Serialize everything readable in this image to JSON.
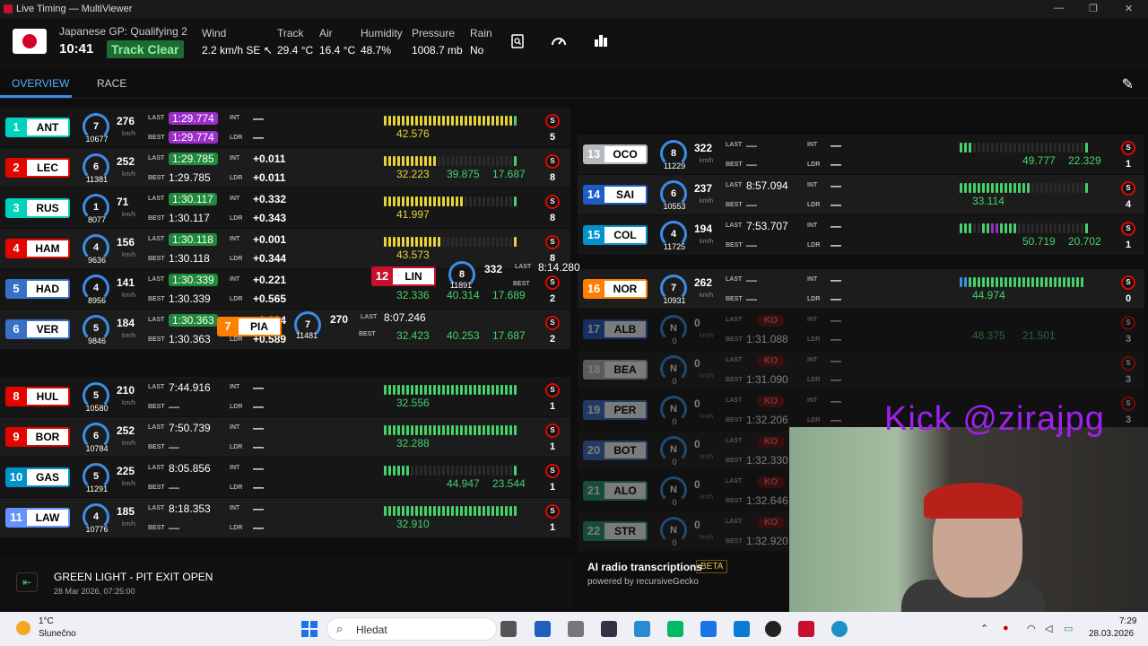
{
  "window": {
    "title": "Live Timing — MultiViewer",
    "min": "—",
    "max": "❐",
    "close": "✕"
  },
  "session": {
    "name": "Japanese GP: Qualifying 2",
    "clock": "10:41",
    "track_status": "Track Clear"
  },
  "weather": [
    {
      "label": "Wind",
      "value": "2.2 km/h SE ↖"
    },
    {
      "label": "Track",
      "value": "29.4 °C"
    },
    {
      "label": "Air",
      "value": "16.4 °C"
    },
    {
      "label": "Humidity",
      "value": "48.7%"
    },
    {
      "label": "Pressure",
      "value": "1008.7 mb"
    },
    {
      "label": "Rain",
      "value": "No"
    }
  ],
  "nav": {
    "tabs": [
      "OVERVIEW",
      "RACE"
    ],
    "active": "OVERVIEW"
  },
  "labels": {
    "last": "LAST",
    "best": "BEST",
    "int": "INT",
    "ldr": "LDR",
    "kmh": "km/h",
    "dash": "—",
    "ko": "KO",
    "tyre": "S"
  },
  "colors": {
    "accent": "#3a8ee6",
    "purple": "#9b2ec9",
    "green": "#1e8a3a",
    "yellow": "#e6d33a"
  },
  "left_drivers": [
    {
      "pos": "1",
      "code": "ANT",
      "team_color": "#00d2be",
      "gear": "7",
      "rpm": "10677",
      "speed": "276",
      "last": "1:29.774",
      "last_style": "purple",
      "best": "1:29.774",
      "best_style": "purple",
      "int": "—",
      "ldr": "—",
      "s1": "42.576",
      "s2": "",
      "s3": "",
      "laps": "5",
      "bars": "yyyyyyyyyyyyyyyyyyyyyyyyyyyyyg"
    },
    {
      "pos": "2",
      "code": "LEC",
      "team_color": "#e10600",
      "gear": "6",
      "rpm": "11381",
      "speed": "252",
      "last": "1:29.785",
      "last_style": "green",
      "best": "1:29.785",
      "best_style": "",
      "int": "+0.011",
      "ldr": "+0.011",
      "s1": "32.223",
      "s2": "39.875",
      "s3": "17.687",
      "laps": "8",
      "bars": "yyyyyyyyyyyy                 g"
    },
    {
      "pos": "3",
      "code": "RUS",
      "team_color": "#00d2be",
      "gear": "1",
      "rpm": "8077",
      "speed": "71",
      "last": "1:30.117",
      "last_style": "green",
      "best": "1:30.117",
      "best_style": "",
      "int": "+0.332",
      "ldr": "+0.343",
      "s1": "41.997",
      "s2": "",
      "s3": "",
      "laps": "8",
      "bars": "yyyyyyyyyyyyyyyyyy           g"
    },
    {
      "pos": "4",
      "code": "HAM",
      "team_color": "#e10600",
      "gear": "4",
      "rpm": "9636",
      "speed": "156",
      "last": "1:30.118",
      "last_style": "green",
      "best": "1:30.118",
      "best_style": "",
      "int": "+0.001",
      "ldr": "+0.344",
      "s1": "43.573",
      "s2": "",
      "s3": "",
      "laps": "8",
      "bars": "yyyyyyyyyyyyy                y"
    },
    {
      "pos": "5",
      "code": "HAD",
      "team_color": "#3671c6",
      "gear": "4",
      "rpm": "8956",
      "speed": "141",
      "last": "1:30.339",
      "last_style": "green",
      "best": "1:30.339",
      "best_style": "",
      "int": "+0.221",
      "ldr": "+0.565",
      "s1": "32.336",
      "s2": "40.314",
      "s3": "17.689",
      "laps": "2",
      "bars": ""
    },
    {
      "pos": "6",
      "code": "VER",
      "team_color": "#3671c6",
      "gear": "5",
      "rpm": "9846",
      "speed": "184",
      "last": "1:30.363",
      "last_style": "green",
      "best": "1:30.363",
      "best_style": "",
      "int": "+0.024",
      "ldr": "+0.589",
      "s1": "32.423",
      "s2": "40.253",
      "s3": "17.687",
      "laps": "2",
      "bars": ""
    },
    {
      "pos": "8",
      "code": "HUL",
      "team_color": "#e10600",
      "gear": "5",
      "rpm": "10580",
      "speed": "210",
      "last": "7:44.916",
      "last_style": "",
      "best": "—",
      "best_style": "",
      "int": "—",
      "ldr": "—",
      "s1": "32.556",
      "s2": "",
      "s3": "",
      "laps": "1",
      "bars": "gggggggggggggggggggggggggggggg"
    },
    {
      "pos": "9",
      "code": "BOR",
      "team_color": "#e10600",
      "gear": "6",
      "rpm": "10784",
      "speed": "252",
      "last": "7:50.739",
      "last_style": "",
      "best": "—",
      "best_style": "",
      "int": "—",
      "ldr": "—",
      "s1": "32.288",
      "s2": "",
      "s3": "",
      "laps": "1",
      "bars": "gggggggggggggggggggggggggggggg"
    },
    {
      "pos": "10",
      "code": "GAS",
      "team_color": "#0093cc",
      "gear": "5",
      "rpm": "11291",
      "speed": "225",
      "last": "8:05.856",
      "last_style": "",
      "best": "—",
      "best_style": "",
      "int": "—",
      "ldr": "—",
      "s1": "",
      "s2": "44.947",
      "s3": "23.544",
      "laps": "1",
      "bars": "gggggg                       g"
    },
    {
      "pos": "11",
      "code": "LAW",
      "team_color": "#6692ff",
      "gear": "4",
      "rpm": "10776",
      "speed": "185",
      "last": "8:18.353",
      "last_style": "",
      "best": "—",
      "best_style": "",
      "int": "—",
      "ldr": "—",
      "s1": "32.910",
      "s2": "",
      "s3": "",
      "laps": "1",
      "bars": "gggggggggggggggggggggggggggggg"
    }
  ],
  "overlay_drivers": [
    {
      "pos": "12",
      "code": "LIN",
      "team_color": "#c8102e",
      "gear": "8",
      "rpm": "11891",
      "speed": "332",
      "last": "8:14.280",
      "best": "—",
      "int": "—",
      "laps": "2"
    },
    {
      "pos": "7",
      "code": "PIA",
      "team_color": "#ff8000",
      "gear": "7",
      "rpm": "11481",
      "speed": "270",
      "last": "8:07.246",
      "best": "—",
      "int": "—",
      "laps": "2"
    }
  ],
  "right_drivers": [
    {
      "pos": "13",
      "code": "OCO",
      "team_color": "#b6babd",
      "gear": "8",
      "rpm": "11229",
      "speed": "322",
      "last": "—",
      "best": "—",
      "int": "—",
      "ldr": "—",
      "s1": "",
      "s2": "49.777",
      "s3": "22.329",
      "laps": "1",
      "ko": false,
      "bars": "ggg                         g"
    },
    {
      "pos": "14",
      "code": "SAI",
      "team_color": "#1e5bc6",
      "gear": "6",
      "rpm": "10553",
      "speed": "237",
      "last": "8:57.094",
      "best": "—",
      "int": "—",
      "ldr": "—",
      "s1": "33.114",
      "s2": "",
      "s3": "",
      "laps": "4",
      "ko": false,
      "bars": "gggggggggggggggg            g"
    },
    {
      "pos": "15",
      "code": "COL",
      "team_color": "#0093cc",
      "gear": "4",
      "rpm": "11725",
      "speed": "194",
      "last": "7:53.707",
      "best": "—",
      "int": "—",
      "ldr": "—",
      "s1": "",
      "s2": "50.719",
      "s3": "20.702",
      "laps": "1",
      "ko": false,
      "bars": "ggg  ggppgggg               g"
    },
    {
      "pos": "16",
      "code": "NOR",
      "team_color": "#ff8000",
      "gear": "7",
      "rpm": "10931",
      "speed": "262",
      "last": "—",
      "best": "—",
      "int": "—",
      "ldr": "—",
      "s1": "44.974",
      "s2": "",
      "s3": "",
      "laps": "0",
      "ko": false,
      "bars": "bbgggggggggggggggggggggggggg"
    },
    {
      "pos": "17",
      "code": "ALB",
      "team_color": "#1e5bc6",
      "gear": "N",
      "rpm": "0",
      "speed": "0",
      "last": "KO",
      "best": "1:31.088",
      "int": "—",
      "ldr": "—",
      "s1": "48.375",
      "s2": "21.501",
      "s3": "",
      "laps": "3",
      "ko": true,
      "bars": ""
    },
    {
      "pos": "18",
      "code": "BEA",
      "team_color": "#b6babd",
      "gear": "N",
      "rpm": "0",
      "speed": "0",
      "last": "KO",
      "best": "1:31.090",
      "int": "—",
      "ldr": "—",
      "s1": "",
      "s2": "",
      "s3": "",
      "laps": "3",
      "ko": true,
      "bars": ""
    },
    {
      "pos": "19",
      "code": "PER",
      "team_color": "#3671c6",
      "gear": "N",
      "rpm": "0",
      "speed": "0",
      "last": "KO",
      "best": "1:32.206",
      "int": "—",
      "ldr": "—",
      "s1": "",
      "s2": "",
      "s3": "",
      "laps": "3",
      "ko": true,
      "bars": ""
    },
    {
      "pos": "20",
      "code": "BOT",
      "team_color": "#3671c6",
      "gear": "N",
      "rpm": "0",
      "speed": "0",
      "last": "KO",
      "best": "1:32.330",
      "int": "",
      "ldr": "",
      "s1": "",
      "s2": "",
      "s3": "",
      "laps": "",
      "ko": true,
      "bars": ""
    },
    {
      "pos": "21",
      "code": "ALO",
      "team_color": "#229971",
      "gear": "N",
      "rpm": "0",
      "speed": "0",
      "last": "KO",
      "best": "1:32.646",
      "int": "",
      "ldr": "",
      "s1": "",
      "s2": "",
      "s3": "",
      "laps": "",
      "ko": true,
      "bars": ""
    },
    {
      "pos": "22",
      "code": "STR",
      "team_color": "#229971",
      "gear": "N",
      "rpm": "0",
      "speed": "0",
      "last": "KO",
      "best": "1:32.920",
      "int": "",
      "ldr": "",
      "s1": "",
      "s2": "",
      "s3": "",
      "laps": "",
      "ko": true,
      "bars": ""
    }
  ],
  "race_control": {
    "message": "GREEN LIGHT - PIT EXIT OPEN",
    "time": "28 Mar 2026, 07:25:00"
  },
  "radio": {
    "title": "AI radio transcriptions",
    "badge": "BETA",
    "powered": "powered by recursiveGecko"
  },
  "stream_overlay": {
    "text": "Kick @zirajpg"
  },
  "taskbar": {
    "temp": "1°C",
    "weather": "Slunečno",
    "search_placeholder": "Hledat",
    "time": "7:29",
    "date": "28.03.2026"
  }
}
